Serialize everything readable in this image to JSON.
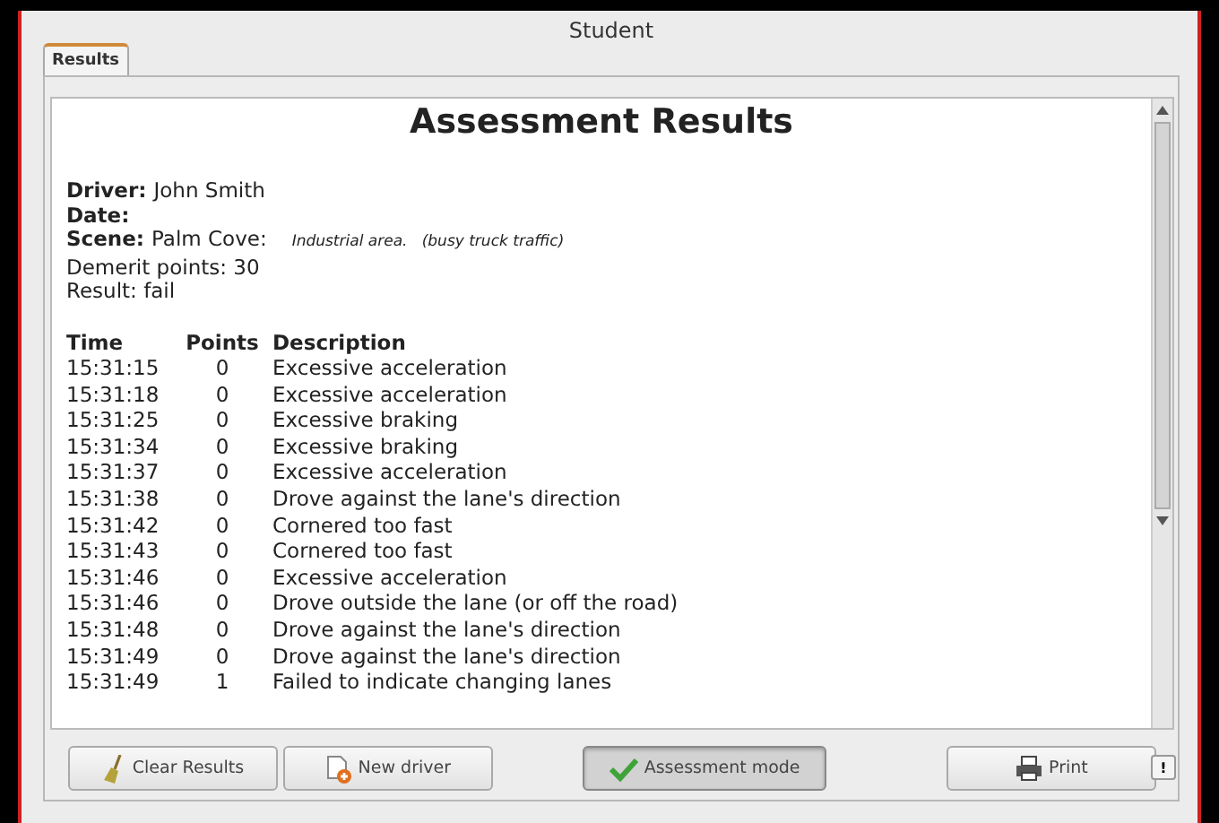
{
  "window": {
    "title": "Student"
  },
  "tabs": [
    {
      "label": "Results",
      "selected": true
    }
  ],
  "report": {
    "title": "Assessment Results",
    "fields": [
      {
        "label": "Driver:",
        "value": "John Smith"
      },
      {
        "label": "Date:"
      },
      {
        "label": "Scene:",
        "value": "Palm Cove:",
        "note": "Industrial area.   (busy truck traffic)"
      }
    ],
    "lines": [
      "Demerit points: 30",
      "Result: fail"
    ],
    "columns": [
      "Time",
      "Points",
      "Description"
    ],
    "rows": [
      [
        "15:31:15",
        "0",
        "Excessive acceleration"
      ],
      [
        "15:31:18",
        "0",
        "Excessive acceleration"
      ],
      [
        "15:31:25",
        "0",
        "Excessive braking"
      ],
      [
        "15:31:34",
        "0",
        "Excessive braking"
      ],
      [
        "15:31:37",
        "0",
        "Excessive acceleration"
      ],
      [
        "15:31:38",
        "0",
        "Drove against the lane's direction"
      ],
      [
        "15:31:42",
        "0",
        "Cornered too fast"
      ],
      [
        "15:31:43",
        "0",
        "Cornered too fast"
      ],
      [
        "15:31:46",
        "0",
        "Excessive acceleration"
      ],
      [
        "15:31:46",
        "0",
        "Drove outside the lane (or off the road)"
      ],
      [
        "15:31:48",
        "0",
        "Drove against the lane's direction"
      ],
      [
        "15:31:49",
        "0",
        "Drove against the lane's direction"
      ],
      [
        "15:31:49",
        "1",
        "Failed to indicate changing lanes"
      ]
    ]
  },
  "buttons": [
    {
      "kind": "clear",
      "label": "Clear Results",
      "pressed": false
    },
    {
      "kind": "new",
      "label": "New driver",
      "pressed": false
    },
    {
      "kind": "assess",
      "label": "Assessment mode",
      "pressed": true
    },
    {
      "kind": "print",
      "label": "Print",
      "pressed": false
    }
  ],
  "corner_button": "!"
}
